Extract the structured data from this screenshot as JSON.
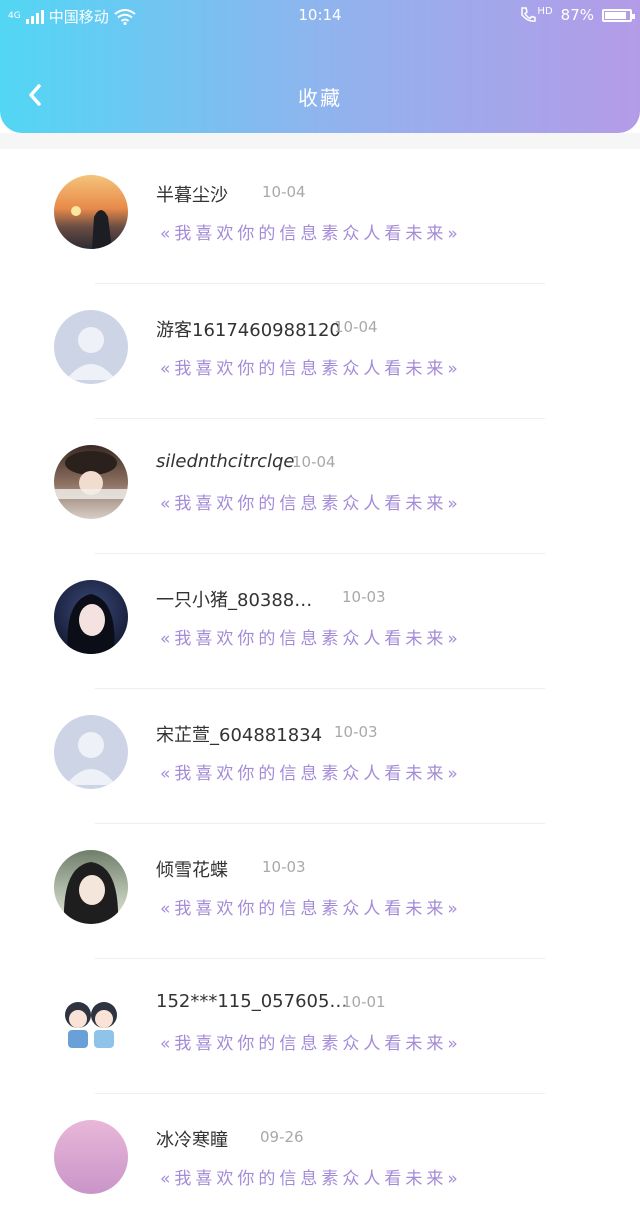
{
  "status_bar": {
    "carrier": "中国移动",
    "time": "10:14",
    "hd": "HD",
    "battery": "87%",
    "battery_level": 0.87
  },
  "header": {
    "title": "收藏"
  },
  "colors": {
    "header_start": "#52d6f4",
    "header_end": "#b49be8",
    "message": "#a48bd8"
  },
  "items": [
    {
      "name": "半暮尘沙",
      "date": "10-04",
      "message": "«我喜欢你的信息素众人看未来»",
      "avatar": "sunset-photo"
    },
    {
      "name": "游客1617460988120",
      "date": "10-04",
      "message": "«我喜欢你的信息素众人看未来»",
      "avatar": "default-user"
    },
    {
      "name": "silednthcitrclqe",
      "date": "10-04",
      "message": "«我喜欢你的信息素众人看未来»",
      "avatar": "girl-hat-photo"
    },
    {
      "name": "一只小猪_80388…",
      "date": "10-03",
      "message": "«我喜欢你的信息素众人看未来»",
      "avatar": "girl-night-photo"
    },
    {
      "name": "宋芷萱_604881834",
      "date": "10-03",
      "message": "«我喜欢你的信息素众人看未来»",
      "avatar": "default-user"
    },
    {
      "name": "倾雪花蝶",
      "date": "10-03",
      "message": "«我喜欢你的信息素众人看未来»",
      "avatar": "anime-girl"
    },
    {
      "name": "152***115_057605…",
      "date": "10-01",
      "message": "«我喜欢你的信息素众人看未来»",
      "avatar": "chibi-boys"
    },
    {
      "name": "冰冷寒瞳",
      "date": "09-26",
      "message": "«我喜欢你的信息素众人看未来»",
      "avatar": "flower-photo"
    }
  ]
}
